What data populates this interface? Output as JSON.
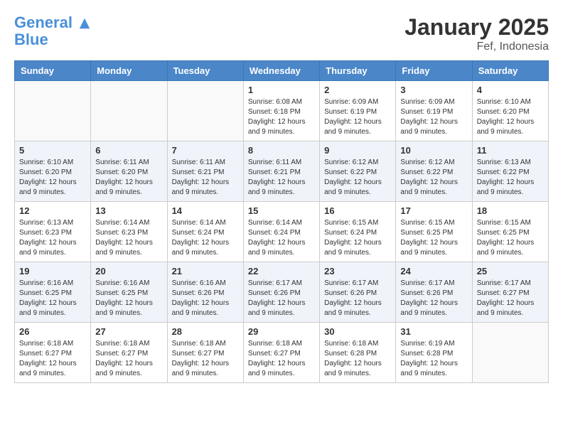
{
  "header": {
    "logo_line1": "General",
    "logo_line2": "Blue",
    "month_title": "January 2025",
    "location": "Fef, Indonesia"
  },
  "weekdays": [
    "Sunday",
    "Monday",
    "Tuesday",
    "Wednesday",
    "Thursday",
    "Friday",
    "Saturday"
  ],
  "weeks": [
    [
      {
        "day": "",
        "info": ""
      },
      {
        "day": "",
        "info": ""
      },
      {
        "day": "",
        "info": ""
      },
      {
        "day": "1",
        "info": "Sunrise: 6:08 AM\nSunset: 6:18 PM\nDaylight: 12 hours and 9 minutes."
      },
      {
        "day": "2",
        "info": "Sunrise: 6:09 AM\nSunset: 6:19 PM\nDaylight: 12 hours and 9 minutes."
      },
      {
        "day": "3",
        "info": "Sunrise: 6:09 AM\nSunset: 6:19 PM\nDaylight: 12 hours and 9 minutes."
      },
      {
        "day": "4",
        "info": "Sunrise: 6:10 AM\nSunset: 6:20 PM\nDaylight: 12 hours and 9 minutes."
      }
    ],
    [
      {
        "day": "5",
        "info": "Sunrise: 6:10 AM\nSunset: 6:20 PM\nDaylight: 12 hours and 9 minutes."
      },
      {
        "day": "6",
        "info": "Sunrise: 6:11 AM\nSunset: 6:20 PM\nDaylight: 12 hours and 9 minutes."
      },
      {
        "day": "7",
        "info": "Sunrise: 6:11 AM\nSunset: 6:21 PM\nDaylight: 12 hours and 9 minutes."
      },
      {
        "day": "8",
        "info": "Sunrise: 6:11 AM\nSunset: 6:21 PM\nDaylight: 12 hours and 9 minutes."
      },
      {
        "day": "9",
        "info": "Sunrise: 6:12 AM\nSunset: 6:22 PM\nDaylight: 12 hours and 9 minutes."
      },
      {
        "day": "10",
        "info": "Sunrise: 6:12 AM\nSunset: 6:22 PM\nDaylight: 12 hours and 9 minutes."
      },
      {
        "day": "11",
        "info": "Sunrise: 6:13 AM\nSunset: 6:22 PM\nDaylight: 12 hours and 9 minutes."
      }
    ],
    [
      {
        "day": "12",
        "info": "Sunrise: 6:13 AM\nSunset: 6:23 PM\nDaylight: 12 hours and 9 minutes."
      },
      {
        "day": "13",
        "info": "Sunrise: 6:14 AM\nSunset: 6:23 PM\nDaylight: 12 hours and 9 minutes."
      },
      {
        "day": "14",
        "info": "Sunrise: 6:14 AM\nSunset: 6:24 PM\nDaylight: 12 hours and 9 minutes."
      },
      {
        "day": "15",
        "info": "Sunrise: 6:14 AM\nSunset: 6:24 PM\nDaylight: 12 hours and 9 minutes."
      },
      {
        "day": "16",
        "info": "Sunrise: 6:15 AM\nSunset: 6:24 PM\nDaylight: 12 hours and 9 minutes."
      },
      {
        "day": "17",
        "info": "Sunrise: 6:15 AM\nSunset: 6:25 PM\nDaylight: 12 hours and 9 minutes."
      },
      {
        "day": "18",
        "info": "Sunrise: 6:15 AM\nSunset: 6:25 PM\nDaylight: 12 hours and 9 minutes."
      }
    ],
    [
      {
        "day": "19",
        "info": "Sunrise: 6:16 AM\nSunset: 6:25 PM\nDaylight: 12 hours and 9 minutes."
      },
      {
        "day": "20",
        "info": "Sunrise: 6:16 AM\nSunset: 6:25 PM\nDaylight: 12 hours and 9 minutes."
      },
      {
        "day": "21",
        "info": "Sunrise: 6:16 AM\nSunset: 6:26 PM\nDaylight: 12 hours and 9 minutes."
      },
      {
        "day": "22",
        "info": "Sunrise: 6:17 AM\nSunset: 6:26 PM\nDaylight: 12 hours and 9 minutes."
      },
      {
        "day": "23",
        "info": "Sunrise: 6:17 AM\nSunset: 6:26 PM\nDaylight: 12 hours and 9 minutes."
      },
      {
        "day": "24",
        "info": "Sunrise: 6:17 AM\nSunset: 6:26 PM\nDaylight: 12 hours and 9 minutes."
      },
      {
        "day": "25",
        "info": "Sunrise: 6:17 AM\nSunset: 6:27 PM\nDaylight: 12 hours and 9 minutes."
      }
    ],
    [
      {
        "day": "26",
        "info": "Sunrise: 6:18 AM\nSunset: 6:27 PM\nDaylight: 12 hours and 9 minutes."
      },
      {
        "day": "27",
        "info": "Sunrise: 6:18 AM\nSunset: 6:27 PM\nDaylight: 12 hours and 9 minutes."
      },
      {
        "day": "28",
        "info": "Sunrise: 6:18 AM\nSunset: 6:27 PM\nDaylight: 12 hours and 9 minutes."
      },
      {
        "day": "29",
        "info": "Sunrise: 6:18 AM\nSunset: 6:27 PM\nDaylight: 12 hours and 9 minutes."
      },
      {
        "day": "30",
        "info": "Sunrise: 6:18 AM\nSunset: 6:28 PM\nDaylight: 12 hours and 9 minutes."
      },
      {
        "day": "31",
        "info": "Sunrise: 6:19 AM\nSunset: 6:28 PM\nDaylight: 12 hours and 9 minutes."
      },
      {
        "day": "",
        "info": ""
      }
    ]
  ]
}
